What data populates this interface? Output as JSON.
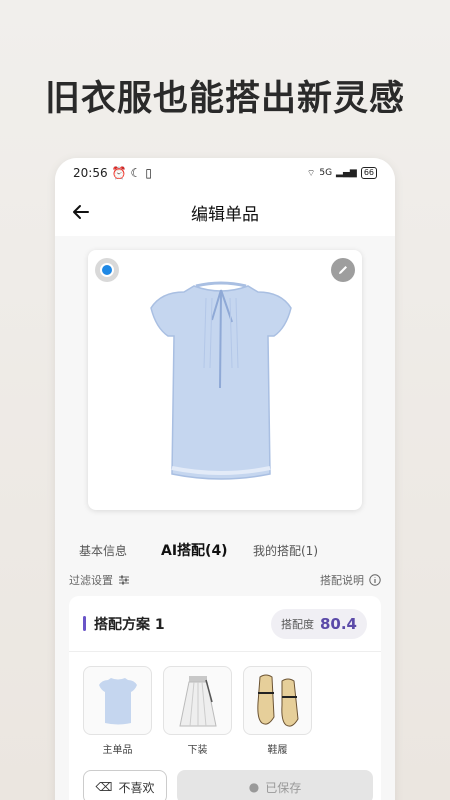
{
  "headline": "旧衣服也能搭出新灵感",
  "status": {
    "time": "20:56",
    "right_text": "5G",
    "battery": "66"
  },
  "nav": {
    "title": "编辑单品"
  },
  "tabs": [
    {
      "label": "基本信息"
    },
    {
      "label": "AI搭配(4)"
    },
    {
      "label": "我的搭配(1)"
    }
  ],
  "filter": {
    "settings": "过滤设置",
    "info": "搭配说明"
  },
  "plan": {
    "title": "搭配方案 1",
    "score_label": "搭配度",
    "score_value": "80.4",
    "items": [
      {
        "label": "主单品"
      },
      {
        "label": "下装"
      },
      {
        "label": "鞋履"
      }
    ],
    "change_button": "不喜欢",
    "saved_button": "已保存"
  },
  "colors": {
    "accent": "#5b4aa8",
    "radio": "#1e88e5"
  }
}
